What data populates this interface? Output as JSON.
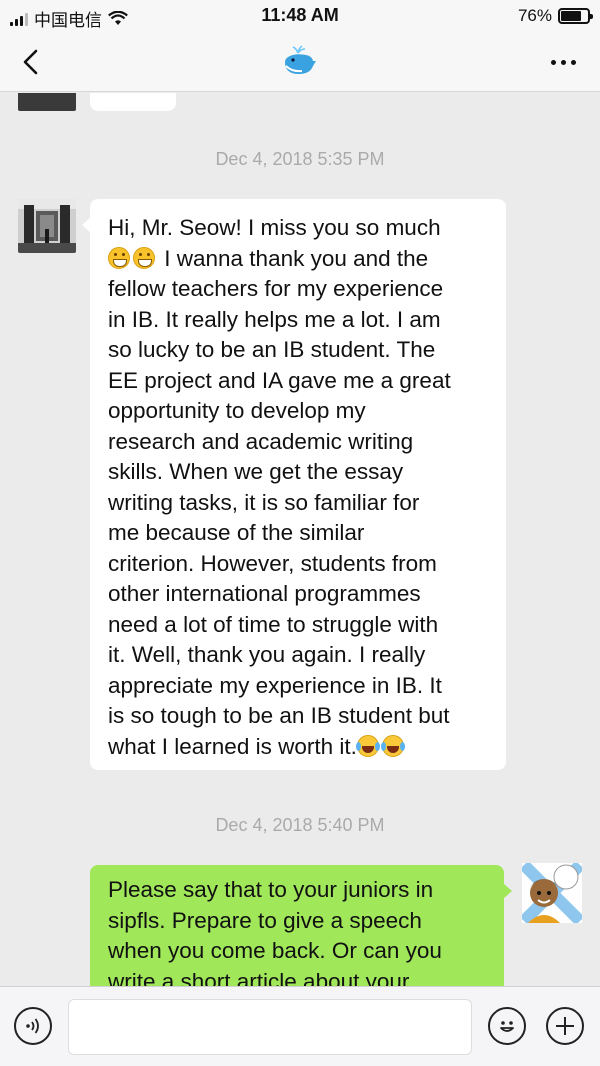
{
  "status_bar": {
    "carrier": "中国电信",
    "time": "11:48 AM",
    "battery_percent_text": "76%",
    "battery_level": 0.76
  },
  "nav": {
    "title_icon": "whale-emoji-icon",
    "back_icon": "chevron-left-icon",
    "more_icon": "more-dots-icon"
  },
  "messages": [
    {
      "timestamp": "Dec 4, 2018 5:35 PM",
      "sender": "other",
      "lines": [
        "Hi, Mr. Seow! I miss you so much",
        " I wanna thank you and the",
        "fellow teachers for my experience",
        "in IB. It really helps me a lot. I am",
        "so lucky to be an IB student. The",
        "EE project and IA gave me a great",
        "opportunity to develop my",
        "research and academic writing",
        "skills. When we get the essay",
        "writing tasks, it is so familiar for",
        "me because of the similar",
        "criterion. However, students from",
        "other international programmes",
        "need a lot of time to struggle with",
        "it. Well, thank you again. I really",
        "appreciate my experience in IB. It",
        "is so tough to be an IB student but",
        "what I learned is worth it."
      ]
    },
    {
      "timestamp": "Dec 4, 2018 5:40 PM",
      "sender": "me",
      "lines": [
        "Please say that to your juniors in",
        "sipfls. Prepare to give a speech",
        "when you come back. Or can you",
        "write a short article about your"
      ]
    }
  ],
  "colors": {
    "chat_bg": "#ebebeb",
    "incoming_bubble": "#ffffff",
    "outgoing_bubble": "#a0e75a",
    "timestamp_text": "#aaaaaa"
  },
  "input_bar": {
    "voice_icon": "voice-icon",
    "emoji_icon": "emoji-icon",
    "add_icon": "plus-icon",
    "text_value": ""
  }
}
